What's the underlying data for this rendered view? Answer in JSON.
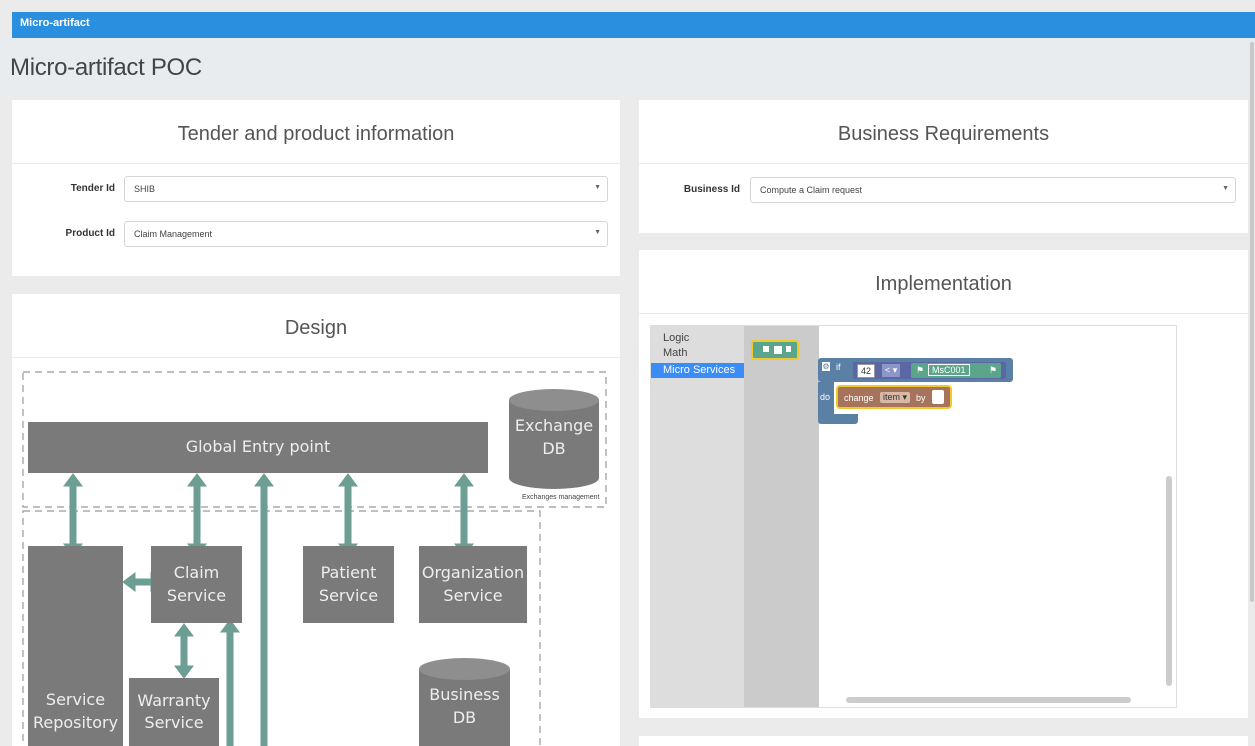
{
  "app": {
    "brand": "Micro-artifact"
  },
  "page": {
    "title": "Micro-artifact POC"
  },
  "tender_panel": {
    "title": "Tender and product information",
    "tender_label": "Tender Id",
    "tender_value": "SHIB",
    "product_label": "Product Id",
    "product_value": "Claim Management"
  },
  "business_panel": {
    "title": "Business Requirements",
    "business_label": "Business Id",
    "business_value": "Compute a Claim request"
  },
  "design_panel": {
    "title": "Design",
    "diagram": {
      "global_entry": "Global Entry point",
      "exchange_db_line1": "Exchange",
      "exchange_db_line2": "DB",
      "exchanges_note": "Exchanges management",
      "claim_line1": "Claim",
      "claim_line2": "Service",
      "patient_line1": "Patient",
      "patient_line2": "Service",
      "org_line1": "Organization",
      "org_line2": "Service",
      "repo_line1": "Service",
      "repo_line2": "Repository",
      "warranty_line1": "Warranty",
      "warranty_line2": "Service",
      "business_db_line1": "Business",
      "business_db_line2": "DB"
    }
  },
  "implementation_panel": {
    "title": "Implementation",
    "toolbox": [
      "Logic",
      "Math",
      "Micro Services"
    ],
    "selected_toolbox": "Micro Services",
    "blocks": {
      "if_kw": "if",
      "num": "42",
      "op": "<",
      "service": "MsC001",
      "do_kw": "do",
      "change_kw": "change",
      "var": "item",
      "by_kw": "by"
    }
  },
  "colors": {
    "topbar": "#2b8fe0",
    "diagram_box": "#7a7a7a",
    "arrow": "#6d9e93",
    "toolbox_selected": "#3b8cf7"
  }
}
